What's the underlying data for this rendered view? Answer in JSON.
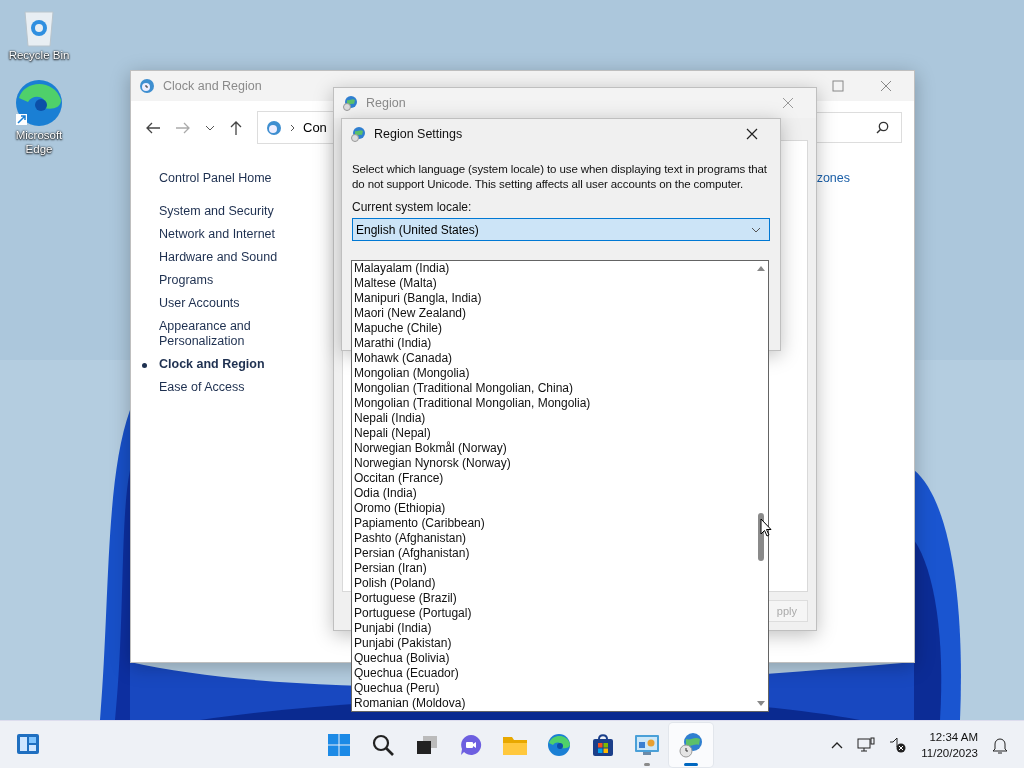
{
  "desktop_icons": [
    {
      "label": "Recycle Bin",
      "kind": "recycle"
    },
    {
      "label": "Microsoft Edge",
      "kind": "edge"
    }
  ],
  "control_panel": {
    "title": "Clock and Region",
    "address": "Con",
    "link": "zones",
    "home": "Control Panel Home",
    "categories": [
      {
        "label": "System and Security",
        "selected": false
      },
      {
        "label": "Network and Internet",
        "selected": false
      },
      {
        "label": "Hardware and Sound",
        "selected": false
      },
      {
        "label": "Programs",
        "selected": false
      },
      {
        "label": "User Accounts",
        "selected": false
      },
      {
        "label": "Appearance and Personalization",
        "selected": false
      },
      {
        "label": "Clock and Region",
        "selected": true
      },
      {
        "label": "Ease of Access",
        "selected": false
      }
    ]
  },
  "region": {
    "title": "Region",
    "apply_button": {
      "label": "pply",
      "disabled": true
    }
  },
  "region_settings": {
    "title": "Region Settings",
    "description": "Select which language (system locale) to use when displaying text in programs that do not support Unicode. This setting affects all user accounts on the computer.",
    "locale_label": "Current system locale:",
    "locale_value": "English (United States)",
    "expanded": true,
    "options": [
      "Malayalam (India)",
      "Maltese (Malta)",
      "Manipuri (Bangla, India)",
      "Maori (New Zealand)",
      "Mapuche (Chile)",
      "Marathi (India)",
      "Mohawk (Canada)",
      "Mongolian (Mongolia)",
      "Mongolian (Traditional Mongolian, China)",
      "Mongolian (Traditional Mongolian, Mongolia)",
      "Nepali (India)",
      "Nepali (Nepal)",
      "Norwegian Bokmål (Norway)",
      "Norwegian Nynorsk (Norway)",
      "Occitan (France)",
      "Odia (India)",
      "Oromo (Ethiopia)",
      "Papiamento (Caribbean)",
      "Pashto (Afghanistan)",
      "Persian (Afghanistan)",
      "Persian (Iran)",
      "Polish (Poland)",
      "Portuguese (Brazil)",
      "Portuguese (Portugal)",
      "Punjabi (India)",
      "Punjabi (Pakistan)",
      "Quechua (Bolivia)",
      "Quechua (Ecuador)",
      "Quechua (Peru)",
      "Romanian (Moldova)"
    ]
  },
  "taskbar": {
    "apps": [
      {
        "kind": "start",
        "running": false,
        "focused": false
      },
      {
        "kind": "search",
        "running": false,
        "focused": false
      },
      {
        "kind": "taskview",
        "running": false,
        "focused": false
      },
      {
        "kind": "chat",
        "running": false,
        "focused": false
      },
      {
        "kind": "folder",
        "running": false,
        "focused": false
      },
      {
        "kind": "edge",
        "running": false,
        "focused": false
      },
      {
        "kind": "store",
        "running": false,
        "focused": false
      },
      {
        "kind": "controlpanel",
        "running": true,
        "focused": false
      },
      {
        "kind": "globe",
        "running": true,
        "focused": true
      }
    ],
    "time": "12:34 AM",
    "date": "11/20/2023"
  }
}
